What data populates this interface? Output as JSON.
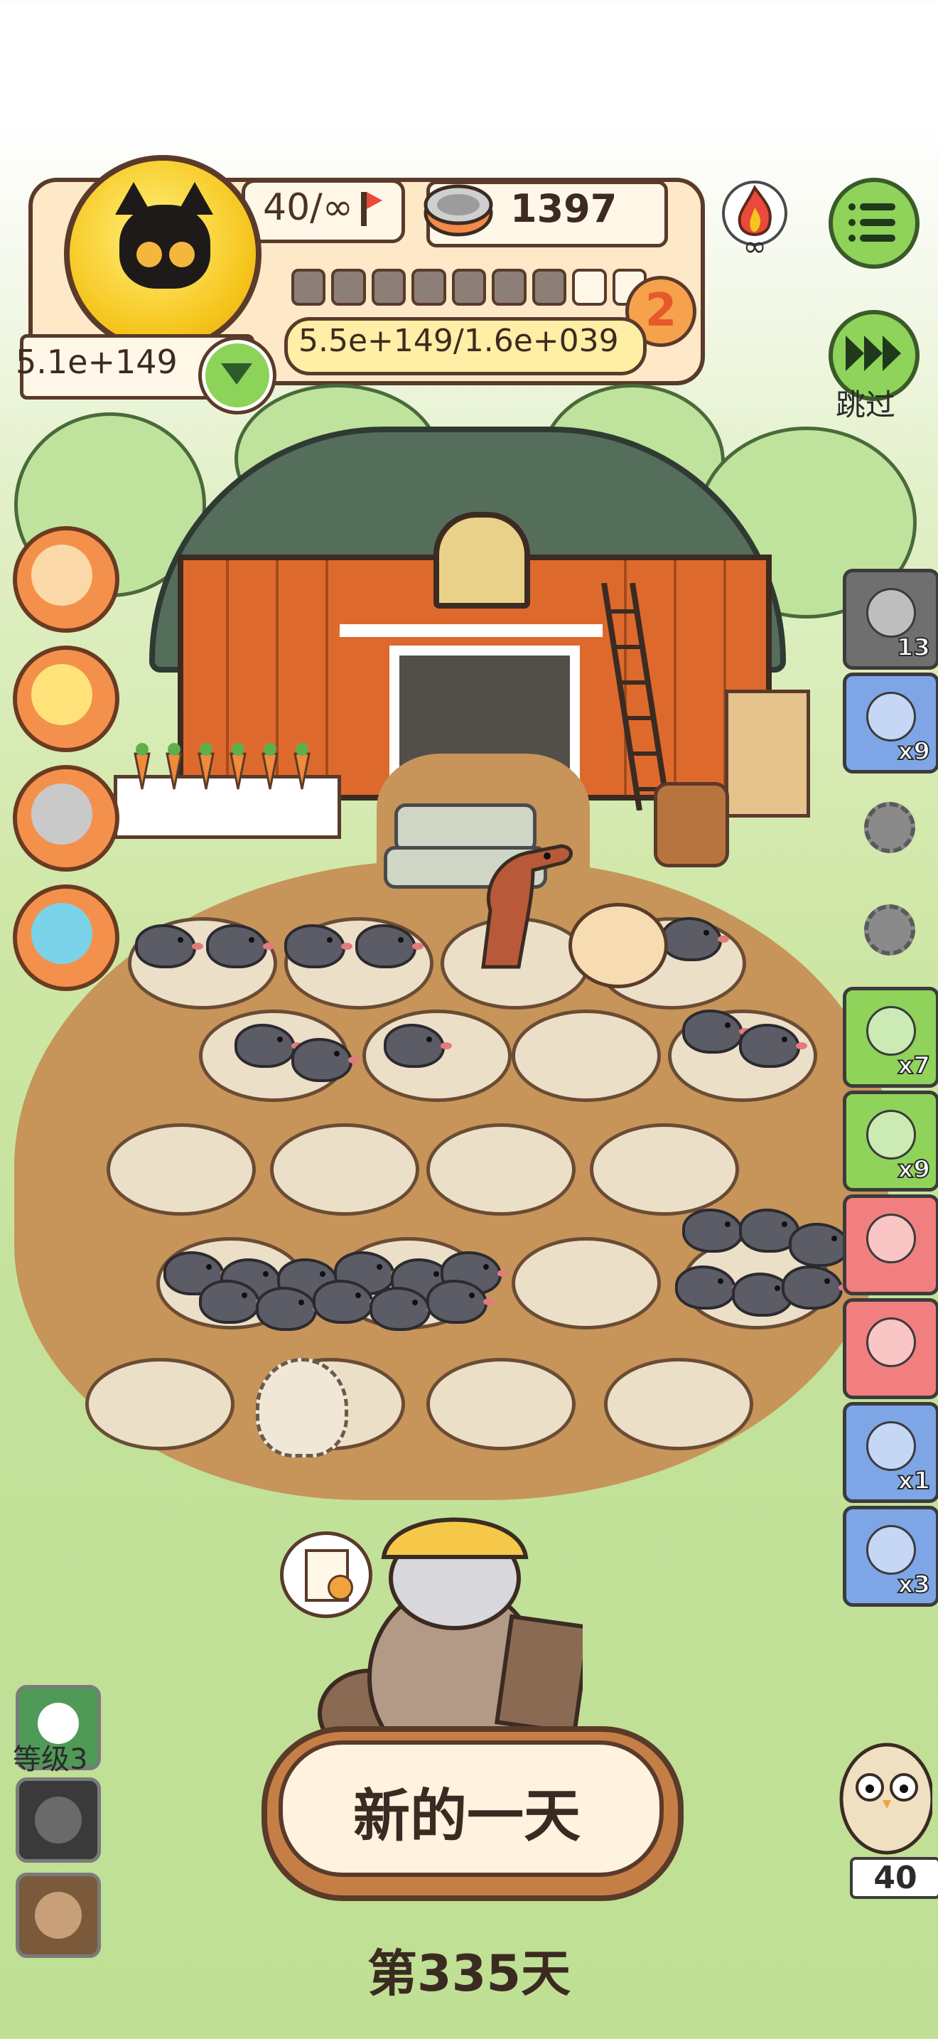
{
  "hud": {
    "level": "40/∞",
    "coins": "1397",
    "progress_filled": 7,
    "progress_total": 9,
    "stage": "2",
    "ratio": "5.5e+149/1.6e+039",
    "cash": "5.1e+149"
  },
  "top_right": {
    "skip_label": "跳过"
  },
  "right_items": [
    {
      "icon": "film-reel-icon",
      "count": "13",
      "color": "#6f6f6f"
    },
    {
      "icon": "seed-bag-icon",
      "count": "x9",
      "color": "#7ea6e6"
    },
    {
      "icon": "tent-icon",
      "count": "x7",
      "color": "#8fd35a"
    },
    {
      "icon": "worm-figure-icon",
      "count": "x9",
      "color": "#8fd35a"
    },
    {
      "icon": "rope-icon",
      "count": "",
      "color": "#f27f7f"
    },
    {
      "icon": "pink-snack-icon",
      "count": "",
      "color": "#f27f7f"
    },
    {
      "icon": "donut-icon",
      "count": "x1",
      "color": "#7ea6e6"
    },
    {
      "icon": "can-icon",
      "count": "x3",
      "color": "#7ea6e6"
    }
  ],
  "bottom": {
    "new_day_label": "新的一天",
    "day_label": "第335天",
    "level_label": "等级3",
    "owl_count": "40"
  },
  "colors": {
    "accent_orange": "#f3914c",
    "button_green": "#8fd35a",
    "dirt": "#c7945a",
    "barn_red": "#dd6a2c"
  }
}
